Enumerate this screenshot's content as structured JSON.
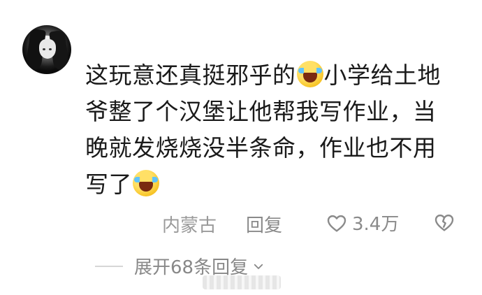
{
  "comment": {
    "line1_text": "这玩意还真挺邪乎的",
    "line1_after_emoji": "小学给土地",
    "line2": "爷整了个汉堡让他帮我写作业，当",
    "line3": "晚就发烧烧没半条命，作业也不用",
    "line4_text": "写了",
    "emoji_name": "laugh-cry-emoji"
  },
  "actions": {
    "location": "内蒙古",
    "reply_label": "回复",
    "like_count": "3.4万"
  },
  "expand": {
    "label": "展开68条回复"
  },
  "icons": {
    "like": "heart-icon",
    "dislike": "broken-heart-icon",
    "chevron": "chevron-down-icon"
  }
}
